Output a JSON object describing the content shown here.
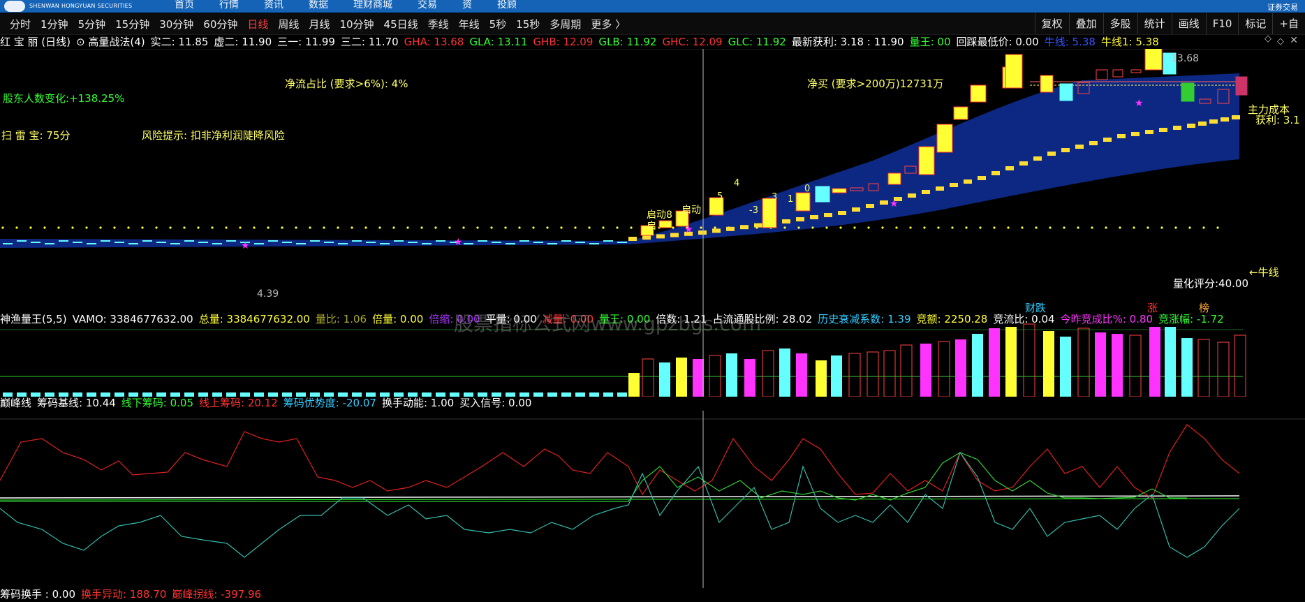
{
  "brand": {
    "name_en": "SHENWAN HONGYUAN SECURITIES"
  },
  "top_nav": [
    "首页",
    "行情",
    "资讯",
    "数据",
    "理财商城",
    "交易",
    "资",
    "投顾"
  ],
  "top_right": "证券交易",
  "periods": [
    {
      "label": "分时",
      "active": false
    },
    {
      "label": "1分钟",
      "active": false
    },
    {
      "label": "5分钟",
      "active": false
    },
    {
      "label": "15分钟",
      "active": false
    },
    {
      "label": "30分钟",
      "active": false
    },
    {
      "label": "60分钟",
      "active": false
    },
    {
      "label": "日线",
      "active": true
    },
    {
      "label": "周线",
      "active": false
    },
    {
      "label": "月线",
      "active": false
    },
    {
      "label": "10分钟",
      "active": false
    },
    {
      "label": "45日线",
      "active": false
    },
    {
      "label": "季线",
      "active": false
    },
    {
      "label": "年线",
      "active": false
    },
    {
      "label": "5秒",
      "active": false
    },
    {
      "label": "15秒",
      "active": false
    },
    {
      "label": "多周期",
      "active": false
    },
    {
      "label": "更多 〉",
      "active": false
    }
  ],
  "tools": [
    "复权",
    "叠加",
    "多股",
    "统计",
    "画线",
    "F10",
    "标记",
    "+自"
  ],
  "main_header": [
    {
      "text": "红 宝 丽 (日线)",
      "color": "#ffffff"
    },
    {
      "text": "⊙ 高量战法(4)",
      "color": "#ffffff"
    },
    {
      "text": "实二: 11.85",
      "color": "#ffffff"
    },
    {
      "text": "虚二: 11.90",
      "color": "#ffffff"
    },
    {
      "text": "三一: 11.99",
      "color": "#ffffff"
    },
    {
      "text": "三二: 11.70",
      "color": "#ffffff"
    },
    {
      "text": "GHA: 13.68",
      "color": "#ff3333"
    },
    {
      "text": "GLA: 13.11",
      "color": "#33ff33"
    },
    {
      "text": "GHB: 12.09",
      "color": "#ff3333"
    },
    {
      "text": "GLB: 11.92",
      "color": "#33ff33"
    },
    {
      "text": "GHC: 12.09",
      "color": "#ff3333"
    },
    {
      "text": "GLC: 11.92",
      "color": "#33ff33"
    },
    {
      "text": "最新获利: 3.18 : 11.90",
      "color": "#ffffff"
    },
    {
      "text": "量王: 00",
      "color": "#33ff33"
    },
    {
      "text": "回踩最低价: 0.00",
      "color": "#ffffff"
    },
    {
      "text": "牛线: 5.38",
      "color": "#3355ff"
    },
    {
      "text": "牛线1: 5.38",
      "color": "#ffff33"
    }
  ],
  "annotations": {
    "holders": "股东人数变化:+138.25%",
    "scan": "扫 雷 宝:  75分",
    "risk": "风险提示:  扣非净利润陡降风险",
    "netflow_ratio": "净流占比 (要求>6%):  4%",
    "net_buy": "净买 (要求>200万)12731万",
    "high_price": "13.68",
    "low_price": "4.39",
    "main_cost": "主力成本",
    "profit": "获利: 3.1",
    "bull_line": "←牛线",
    "quant_score": "量化评分:40.00",
    "start1": "启动8",
    "start2": "启动",
    "start3": "启",
    "num5": "5",
    "num4": "4",
    "num3": "3",
    "num1": "1",
    "num0": "0",
    "numm3": "-3"
  },
  "vol_header": [
    {
      "text": "神渔量王(5,5)",
      "color": "#ffffff"
    },
    {
      "text": "VAMO: 3384677632.00",
      "color": "#ffffff"
    },
    {
      "text": "总量: 3384677632.00",
      "color": "#ffff33"
    },
    {
      "text": "量比: 1.06",
      "color": "#aaaa33"
    },
    {
      "text": "倍量: 0.00",
      "color": "#ffff33"
    },
    {
      "text": "倍缩: 0.00",
      "color": "#aa33ff"
    },
    {
      "text": "平量: 0.00",
      "color": "#ffffff"
    },
    {
      "text": "减量: 0.00",
      "color": "#ff3333"
    },
    {
      "text": "量王: 0.00",
      "color": "#33ff33"
    },
    {
      "text": "倍数: 1.21",
      "color": "#ffffff"
    },
    {
      "text": "占流通股比例: 28.02",
      "color": "#ffffff"
    },
    {
      "text": "历史衰减系数: 1.39",
      "color": "#33ccff"
    },
    {
      "text": "竞额: 2250.28",
      "color": "#ffff33"
    },
    {
      "text": "竞流比: 0.04",
      "color": "#ffffff"
    },
    {
      "text": "今昨竞成比%: 0.80",
      "color": "#ff33ff"
    },
    {
      "text": "竞涨幅: -1.72",
      "color": "#33ff33"
    }
  ],
  "vol_labels": {
    "cai_die": "财跌",
    "zhang": "涨",
    "bang": "榜"
  },
  "watermark": "股票指标公式网www.gpzbgs.com",
  "peak_header": [
    {
      "text": "巅峰线",
      "color": "#ffffff"
    },
    {
      "text": "筹码基线: 10.44",
      "color": "#ffffff"
    },
    {
      "text": "线下筹码: 0.05",
      "color": "#33ff33"
    },
    {
      "text": "线上筹码: 20.12",
      "color": "#ff3333"
    },
    {
      "text": "筹码优势度: -20.07",
      "color": "#33ccff"
    },
    {
      "text": "换手动能: 1.00",
      "color": "#ffffff"
    },
    {
      "text": "买入信号: 0.00",
      "color": "#ffffff"
    }
  ],
  "bottom_header": [
    {
      "text": "筹码换手 : 0.00",
      "color": "#ffffff"
    },
    {
      "text": "换手异动: 188.70",
      "color": "#ff3333"
    },
    {
      "text": "巅峰拐线: -397.96",
      "color": "#ff3333"
    }
  ],
  "colors": {
    "up": "#ffff33",
    "down": "#66ffff",
    "red_line": "#ff3333",
    "band": "#0d2a8a"
  }
}
